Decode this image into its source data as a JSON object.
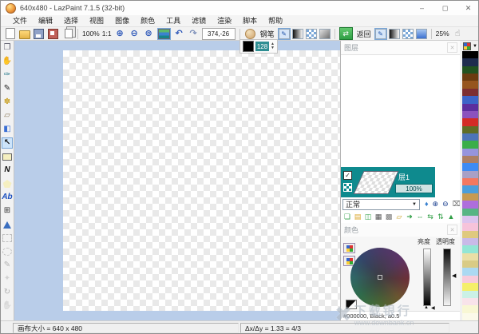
{
  "window": {
    "title": "640x480 - LazPaint 7.1.5 (32-bit)",
    "minimize": "–",
    "maximize": "◻",
    "close": "✕"
  },
  "menu": {
    "items": [
      "文件",
      "编辑",
      "选择",
      "视图",
      "图像",
      "颜色",
      "工具",
      "滤镜",
      "渲染",
      "脚本",
      "帮助"
    ]
  },
  "toolbar": {
    "zoom_level": "100%",
    "actual_size": "1:1",
    "coordinates": "374,-26",
    "tool_name": "钢笔",
    "back_label": "返回",
    "tolerance": "25%"
  },
  "glyphs": {
    "undo": "↶",
    "redo": "↷",
    "zoom_in": "⊕",
    "zoom_out": "⊖",
    "zoom_fit": "⊚",
    "swap": "⇄",
    "thumb": "☝",
    "caret_down": "▼",
    "check": "✓",
    "close": "✕",
    "spin_up": "▲",
    "spin_down": "▼"
  },
  "tool_options": {
    "pen_width": "128"
  },
  "tools": [
    {
      "name": "move-layer-tool",
      "glyph": "❐",
      "color": "#556"
    },
    {
      "name": "hand-tool",
      "glyph": "✋",
      "color": "#c49a5a"
    },
    {
      "name": "color-picker-tool",
      "glyph": "✑",
      "color": "#2e7d8f"
    },
    {
      "name": "pen-tool",
      "glyph": "✎",
      "color": "#222"
    },
    {
      "name": "brush-tool",
      "glyph": "✽",
      "color": "#c9a227"
    },
    {
      "name": "eraser-tool",
      "glyph": "▱",
      "color": "#8a7a5a"
    },
    {
      "name": "fill-tool",
      "glyph": "◧",
      "color": "#3b6fd4"
    },
    {
      "name": "edit-shape-tool",
      "glyph": "↖",
      "color": "#111",
      "selected": true,
      "strong": true
    },
    {
      "name": "rectangle-tool",
      "shape": "rect"
    },
    {
      "name": "polyline-tool",
      "glyph": "N",
      "color": "#111",
      "strong": true
    },
    {
      "name": "polygon-tool",
      "shape": "pent"
    },
    {
      "name": "text-tool",
      "glyph": "Ab",
      "color": "#1a4fbf",
      "strong": true
    },
    {
      "name": "deformation-grid-tool",
      "glyph": "⊞",
      "color": "#333"
    },
    {
      "name": "texture-mapping-tool",
      "shape": "tri"
    },
    {
      "name": "rect-select-tool",
      "shape": "dash-rect",
      "disabled": true
    },
    {
      "name": "ellipse-select-tool",
      "shape": "dash-ellipse",
      "disabled": true
    },
    {
      "name": "pen-select-tool",
      "glyph": "✎",
      "color": "#555",
      "disabled": true
    },
    {
      "name": "magic-wand-tool",
      "glyph": "✦",
      "color": "#c9a227",
      "disabled": true
    },
    {
      "name": "rotate-selection-tool",
      "glyph": "↻",
      "color": "#555",
      "disabled": true
    },
    {
      "name": "move-selection-tool",
      "glyph": "✋",
      "color": "#8a7a5a",
      "disabled": true
    }
  ],
  "layers": {
    "panel_title": "图层",
    "layer_name": "层1",
    "layer_opacity": "100%",
    "blend_mode": "正常",
    "controls": [
      {
        "name": "flip-layer-icon",
        "glyph": "♦",
        "color": "#3b82d0"
      },
      {
        "name": "zoom-in-layer-icon",
        "glyph": "⊕",
        "color": "#1a3f8f"
      },
      {
        "name": "zoom-out-layer-icon",
        "glyph": "⊖",
        "color": "#1a3f8f"
      },
      {
        "name": "delete-layer-icon",
        "glyph": "⌧",
        "color": "#666"
      }
    ],
    "actions": [
      {
        "name": "new-layer-button",
        "glyph": "❏",
        "color": "#2f9e44"
      },
      {
        "name": "open-layer-button",
        "glyph": "▤",
        "color": "#d9a528"
      },
      {
        "name": "duplicate-layer-button",
        "glyph": "◫",
        "color": "#2f9e44"
      },
      {
        "name": "rasterize-layer-button",
        "glyph": "▦",
        "color": "#555"
      },
      {
        "name": "merge-layer-button",
        "glyph": "▩",
        "color": "#777"
      },
      {
        "name": "erase-layer-button",
        "glyph": "▱",
        "color": "#c9a227"
      },
      {
        "name": "shift-layer-button",
        "glyph": "➜",
        "color": "#2f9e44"
      },
      {
        "name": "stretch-layer-button",
        "glyph": "⇔",
        "color": "#2f9e44"
      },
      {
        "name": "flip-horizontal-button",
        "glyph": "⇆",
        "color": "#2f9e44"
      },
      {
        "name": "flip-vertical-button",
        "glyph": "⇅",
        "color": "#2f9e44"
      },
      {
        "name": "rotate-layer-button",
        "glyph": "▲",
        "color": "#2f9e44"
      }
    ]
  },
  "colors": {
    "panel_title": "颜色",
    "lightness_label": "亮度",
    "opacity_label": "透明度",
    "color_info": "#000000, Black, a0.5"
  },
  "palette": {
    "colors": [
      "#000000",
      "#1e2b4e",
      "#21511f",
      "#6a3b10",
      "#96551e",
      "#7d2e31",
      "#3c64c8",
      "#5c2e9e",
      "#8b52be",
      "#d32b25",
      "#5f6d26",
      "#4c74b8",
      "#3bae49",
      "#9694dc",
      "#ad7f63",
      "#3e8bf2",
      "#a8a0c6",
      "#f4785f",
      "#4b9edc",
      "#c79a52",
      "#ae6edc",
      "#57b584",
      "#dcc4ee",
      "#f6c3da",
      "#dfc97e",
      "#c9bae8",
      "#93e6d5",
      "#eadfa6",
      "#d9cb85",
      "#abd9f2",
      "#f7cbdb",
      "#f5ef6a",
      "#cbf1e6",
      "#f8e3ea",
      "#f8f7d4",
      "#fbfaea"
    ]
  },
  "status": {
    "canvas_size": "画布大小 = 640 x 480",
    "aspect_ratio": "Δx/Δy = 1.33 = 4/3"
  },
  "watermark": {
    "name": "下载银行",
    "url": "www.downbank.cn"
  }
}
